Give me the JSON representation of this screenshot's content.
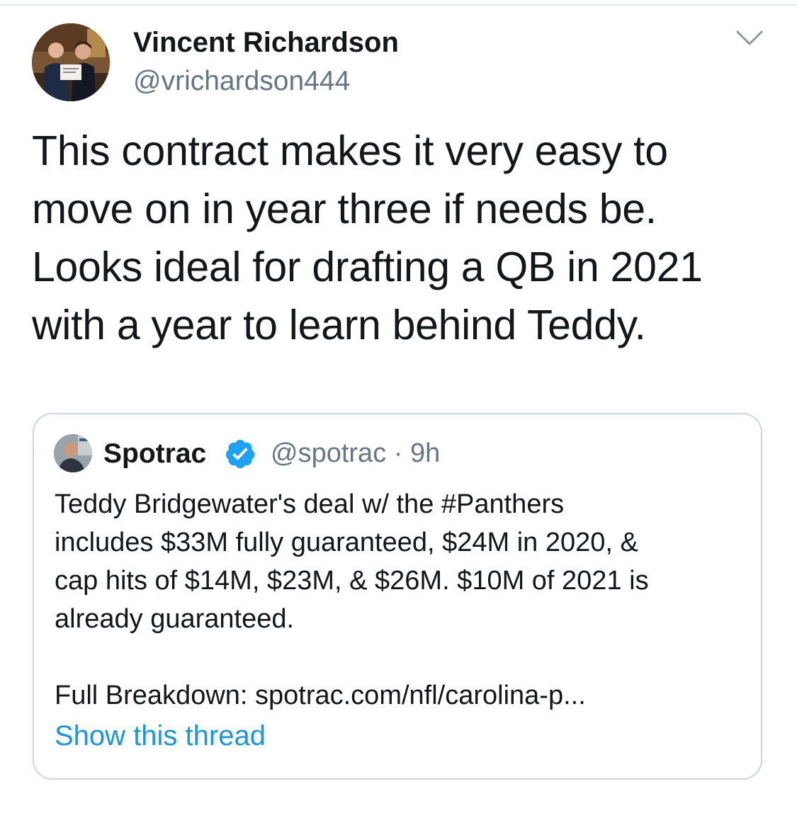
{
  "tweet": {
    "author_name": "Vincent Richardson",
    "author_handle": "@vrichardson444",
    "text_lines": [
      "This contract makes it very easy to",
      "move on in year three if needs be.",
      "Looks ideal for drafting a QB in 2021",
      "with a year to learn behind Teddy."
    ],
    "menu_icon": "chevron-down-icon"
  },
  "quote": {
    "author_name": "Spotrac",
    "verified_icon": "verified-badge-icon",
    "handle_time": "@spotrac · 9h",
    "body_lines": [
      "Teddy Bridgewater's deal w/ the #Panthers",
      "includes $33M fully guaranteed, $24M in 2020, &",
      "cap hits of $14M, $23M, & $26M. $10M of 2021 is",
      "already guaranteed.",
      "",
      "Full Breakdown: spotrac.com/nfl/carolina-p..."
    ],
    "show_thread_label": "Show this thread"
  },
  "colors": {
    "text": "#14171a",
    "secondary": "#657786",
    "link": "#1b95e0",
    "verified": "#1da1f2",
    "border": "#ccd6dd"
  }
}
